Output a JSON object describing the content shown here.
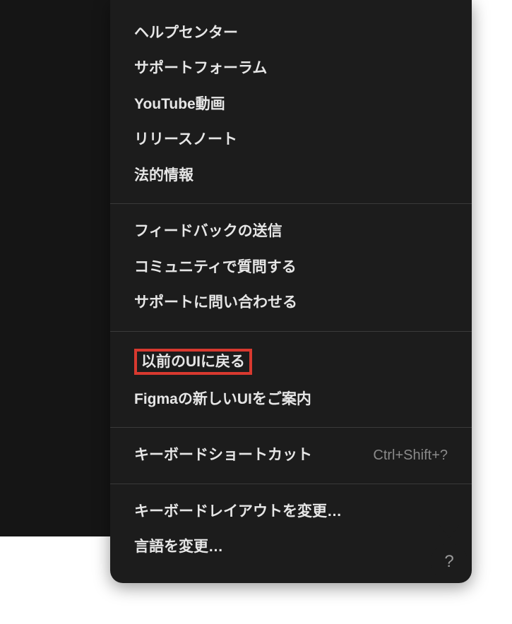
{
  "menu": {
    "group1": [
      "ヘルプセンター",
      "サポートフォーラム",
      "YouTube動画",
      "リリースノート",
      "法的情報"
    ],
    "group2": [
      "フィードバックの送信",
      "コミュニティで質問する",
      "サポートに問い合わせる"
    ],
    "group3": {
      "back_to_old_ui": "以前のUIに戻る",
      "new_ui_tour": "Figmaの新しいUIをご案内"
    },
    "group4": {
      "keyboard_shortcuts": "キーボードショートカット",
      "keyboard_shortcuts_key": "Ctrl+Shift+?"
    },
    "group5": [
      "キーボードレイアウトを変更…",
      "言語を変更…"
    ]
  },
  "help_button": "?",
  "colors": {
    "highlight": "#d8392f",
    "menu_bg": "#1c1c1c",
    "sidebar_bg": "#151515"
  }
}
